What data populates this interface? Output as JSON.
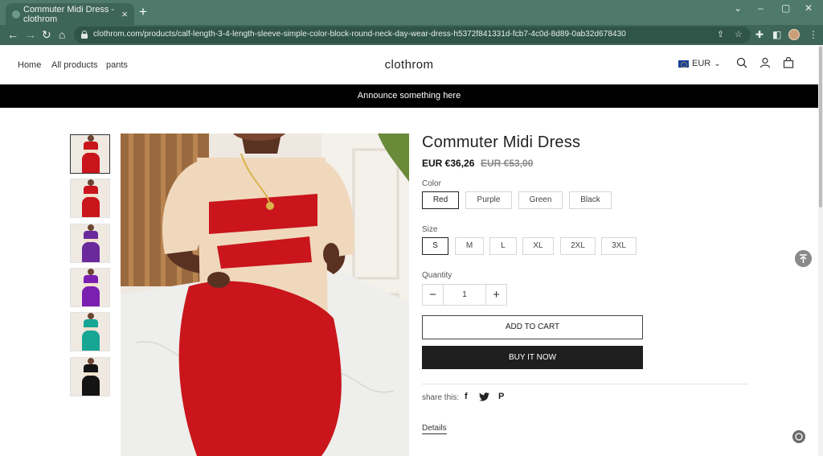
{
  "browser": {
    "tab_title": "Commuter Midi Dress - clothrom",
    "tab_close": "×",
    "new_tab": "+",
    "url": "clothrom.com/products/calf-length-3-4-length-sleeve-simple-color-block-round-neck-day-wear-dress-h5372f841331d-fcb7-4c0d-8d89-0ab32d678430",
    "window_controls": [
      "⌄",
      "–",
      "▢",
      "✕"
    ],
    "nav": {
      "back": "←",
      "forward": "→",
      "reload": "↻",
      "home": "⌂"
    }
  },
  "store": {
    "nav_links": [
      "Home",
      "All products",
      "pants"
    ],
    "brand": "clothrom",
    "currency": "EUR",
    "currency_caret": "⌄",
    "announcement": "Announce something here"
  },
  "product": {
    "title": "Commuter Midi Dress",
    "price": "EUR €36,26",
    "compare_price": "EUR €53,00",
    "color_label": "Color",
    "colors": [
      "Red",
      "Purple",
      "Green",
      "Black"
    ],
    "selected_color": "Red",
    "size_label": "Size",
    "sizes": [
      "S",
      "M",
      "L",
      "XL",
      "2XL",
      "3XL"
    ],
    "selected_size": "S",
    "quantity_label": "Quantity",
    "quantity": "1",
    "minus": "−",
    "plus": "+",
    "add_to_cart": "ADD TO CART",
    "buy_now": "BUY IT NOW",
    "share_label": "share this:",
    "share_icons": [
      "f",
      "🐦",
      "P"
    ],
    "details": "Details",
    "thumbnail_colors": [
      "#c9151b",
      "#c9151b",
      "#6a2a9c",
      "#7a1fb0",
      "#17a594",
      "#141414"
    ]
  },
  "colors": {
    "chrome_tab": "#4f7a6b",
    "chrome_toolbar": "#3e6658",
    "announce_bg": "#000000",
    "button_dark": "#1f1f1f",
    "dress_red": "#c9151b",
    "dress_beige": "#f0d8bd"
  }
}
